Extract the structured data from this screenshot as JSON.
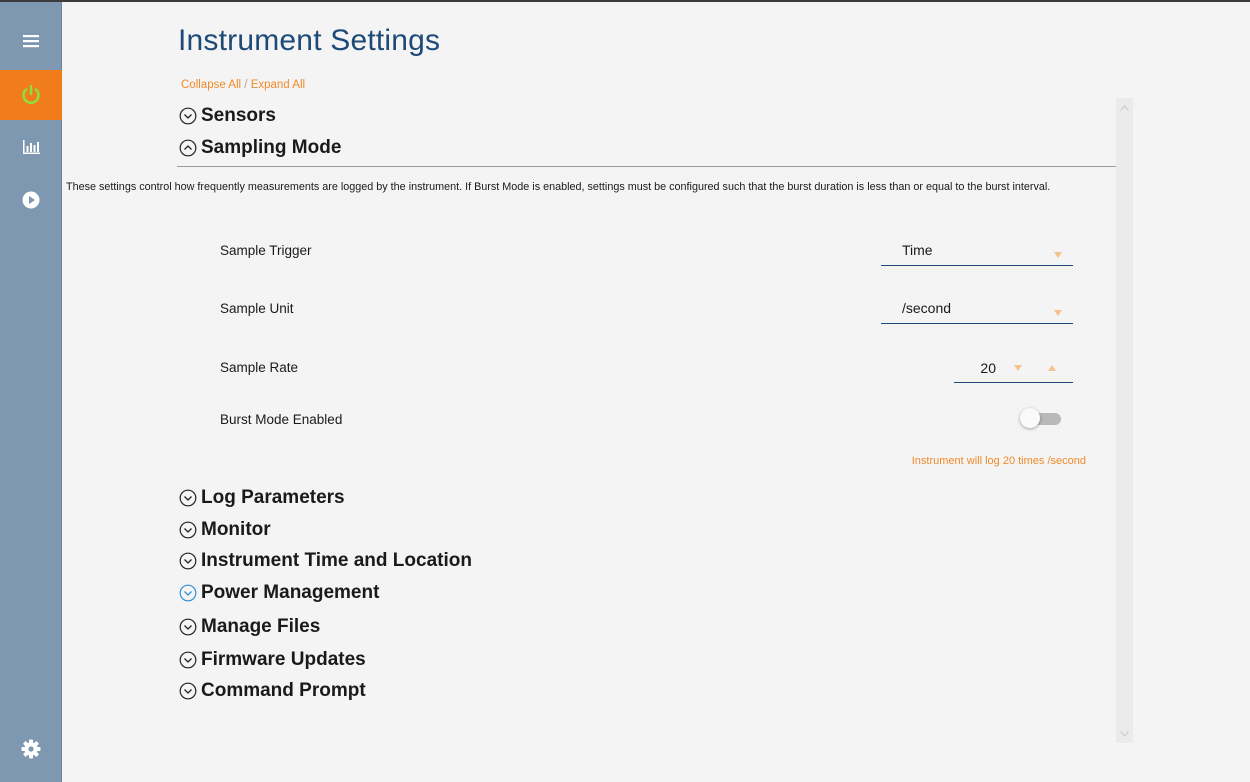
{
  "header": {
    "title": "Instrument Settings",
    "collapse_all": "Collapse All",
    "separator": "/",
    "expand_all": "Expand All"
  },
  "sidebar": {
    "items": [
      {
        "icon": "hamburger-menu-icon",
        "active": false
      },
      {
        "icon": "power-icon",
        "active": true
      },
      {
        "icon": "bar-chart-icon",
        "active": false
      },
      {
        "icon": "play-icon",
        "active": false
      },
      {
        "icon": "gear-icon",
        "active": false
      }
    ]
  },
  "sections": {
    "sensors": "Sensors",
    "sampling_mode": "Sampling Mode",
    "log_parameters": "Log Parameters",
    "monitor": "Monitor",
    "instrument_time_location": "Instrument Time and Location",
    "power_management": "Power Management",
    "manage_files": "Manage Files",
    "firmware_updates": "Firmware Updates",
    "command_prompt": "Command Prompt"
  },
  "sampling": {
    "description": "These settings control how frequently measurements are logged by the instrument. If Burst Mode is enabled, settings must be configured such that the burst duration is less than or equal to the burst interval.",
    "sample_trigger_label": "Sample Trigger",
    "sample_trigger_value": "Time",
    "sample_unit_label": "Sample Unit",
    "sample_unit_value": "/second",
    "sample_rate_label": "Sample Rate",
    "sample_rate_value": "20",
    "burst_mode_label": "Burst Mode Enabled",
    "burst_mode_enabled": false,
    "summary": "Instrument will log 20 times /second"
  },
  "colors": {
    "sidebar_bg": "#7d98b0",
    "accent_orange": "#f07c1c",
    "title_blue": "#1e4a78",
    "focus_blue": "#2d8fd9"
  }
}
